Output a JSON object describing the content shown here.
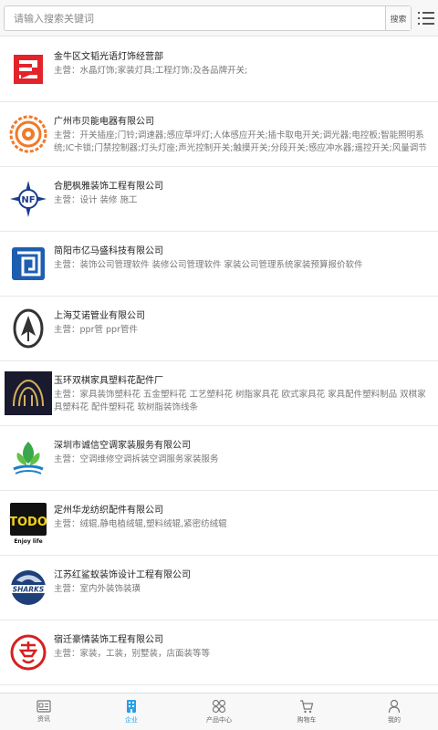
{
  "search": {
    "placeholder": "请输入搜索关键词",
    "button_label": "搜索"
  },
  "list": {
    "label_prefix": "主营：",
    "items": [
      {
        "name": "金牛区文韬光语灯饰经营部",
        "desc": "水晶灯饰;家装灯具;工程灯饰;及各品牌开关;",
        "logo": "red-letter-logo"
      },
      {
        "name": "广州市贝能电器有限公司",
        "desc": "开关插座;门铃;调速器;感应草坪灯;人体感应开关;插卡取电开关;调光器;电控板;智能照明系统;IC卡锁;门禁控制器;灯头灯座;声光控制开关;触摸开关;分段开关;感应冲水器;遥控开关;风量调节开关;感应吸顶灯",
        "logo": "orange-ornament-logo"
      },
      {
        "name": "合肥枫雅装饰工程有限公司",
        "desc": "设计 装修 施工",
        "logo": "nf-compass-logo"
      },
      {
        "name": "简阳市亿马盛科技有限公司",
        "desc": "装饰公司管理软件 装修公司管理软件 家装公司管理系统家装预算报价软件",
        "logo": "blue-square-spiral-logo"
      },
      {
        "name": "上海艾诺管业有限公司",
        "desc": "ppr管 ppr管件",
        "logo": "arrow-oval-logo"
      },
      {
        "name": "玉环双棋家具塑料花配件厂",
        "desc": "家具装饰塑料花 五金塑料花 工艺塑料花 树脂家具花 欧式家具花 家具配件塑料制品 双棋家具塑料花 配件塑料花 软树脂装饰线条",
        "logo": "dark-emblem-logo"
      },
      {
        "name": "深圳市诚信空调家装服务有限公司",
        "desc": "空调维修空调拆装空调服务家装服务",
        "logo": "green-blue-leaf-logo"
      },
      {
        "name": "定州华龙纺织配件有限公司",
        "desc": "绒辊,静电植绒辊,塑料绒辊,紧密纺绒辊",
        "logo": "todo-enjoy-life-logo"
      },
      {
        "name": "江苏红鲨蚁装饰设计工程有限公司",
        "desc": "室内外装饰装璜",
        "logo": "sharks-badge-logo"
      },
      {
        "name": "宿迁豪情装饰工程有限公司",
        "desc": "家装，工装，别墅装，店面装等等",
        "logo": "red-circle-seal-logo"
      }
    ]
  },
  "sharks_logo_text": "SHARKS",
  "todo_logo_text": "TODO",
  "todo_logo_sub": "Enjoy life",
  "nf_logo_text": "NF",
  "tabbar": {
    "active_color": "#2aa0e6",
    "tabs": [
      {
        "label": "资讯",
        "icon": "news-icon"
      },
      {
        "label": "企业",
        "icon": "building-icon",
        "active": true
      },
      {
        "label": "产品中心",
        "icon": "grid-icon"
      },
      {
        "label": "购物车",
        "icon": "cart-icon"
      },
      {
        "label": "我的",
        "icon": "user-icon"
      }
    ]
  }
}
